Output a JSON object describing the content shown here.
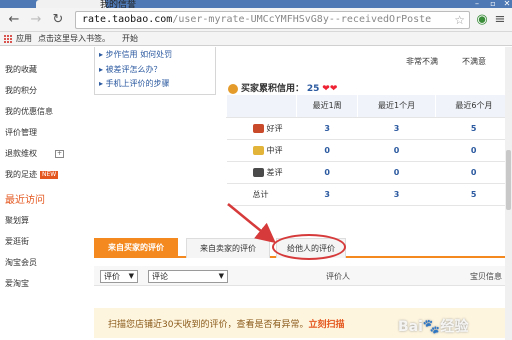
{
  "browser": {
    "tab_title": "我的信誉",
    "url_host": "rate.taobao.com",
    "url_path": "/user-myrate-UMCcYMFHSvG8y--receivedOrPoste",
    "bookmarks": {
      "apps_label": "应用",
      "import_label": "点击这里导入书签。",
      "start_label": "开始"
    }
  },
  "sidebar": {
    "items": [
      "我的收藏",
      "我的积分",
      "我的优惠信息",
      "评价管理",
      "退款维权",
      "我的足迹"
    ],
    "new_badge": "NEW",
    "expand_symbol": "+",
    "recent_heading": "最近访问",
    "recent_items": [
      "聚划算",
      "爱逛街",
      "淘宝会员",
      "爱淘宝"
    ]
  },
  "help_box": {
    "links": [
      "步作信用 如何处罚",
      "被差评怎么办？",
      "手机上评价的步骤"
    ]
  },
  "top_columns": [
    "非常不满",
    "不满意"
  ],
  "credit": {
    "label": "买家累积信用：",
    "value": "25",
    "hearts": "❤❤"
  },
  "stats_table": {
    "headers": [
      "最近1周",
      "最近1个月",
      "最近6个月"
    ],
    "rows": [
      {
        "label": "好评",
        "values": [
          "3",
          "3",
          "5"
        ],
        "color": "#c94a2a"
      },
      {
        "label": "中评",
        "values": [
          "0",
          "0",
          "0"
        ],
        "color": "#e2b43a"
      },
      {
        "label": "差评",
        "values": [
          "0",
          "0",
          "0"
        ],
        "color": "#4a4a4a"
      },
      {
        "label": "总计",
        "values": [
          "3",
          "3",
          "5"
        ],
        "color": ""
      }
    ]
  },
  "tabs": [
    {
      "label": "来自买家的评价",
      "active": true
    },
    {
      "label": "来自卖家的评价",
      "active": false
    },
    {
      "label": "给他人的评价",
      "active": false
    }
  ],
  "filters": {
    "select1": "评价",
    "select2": "评论",
    "col_rater": "评价人",
    "col_item": "宝贝信息"
  },
  "notice": {
    "text": "扫描您店铺近30天收到的评价，查看是否有异常。",
    "link": "立刻扫描"
  },
  "watermark": "Bai🐾经验",
  "colors": {
    "accent": "#f48a1f",
    "annotation": "#d63a3a",
    "link": "#2c5aa0"
  }
}
